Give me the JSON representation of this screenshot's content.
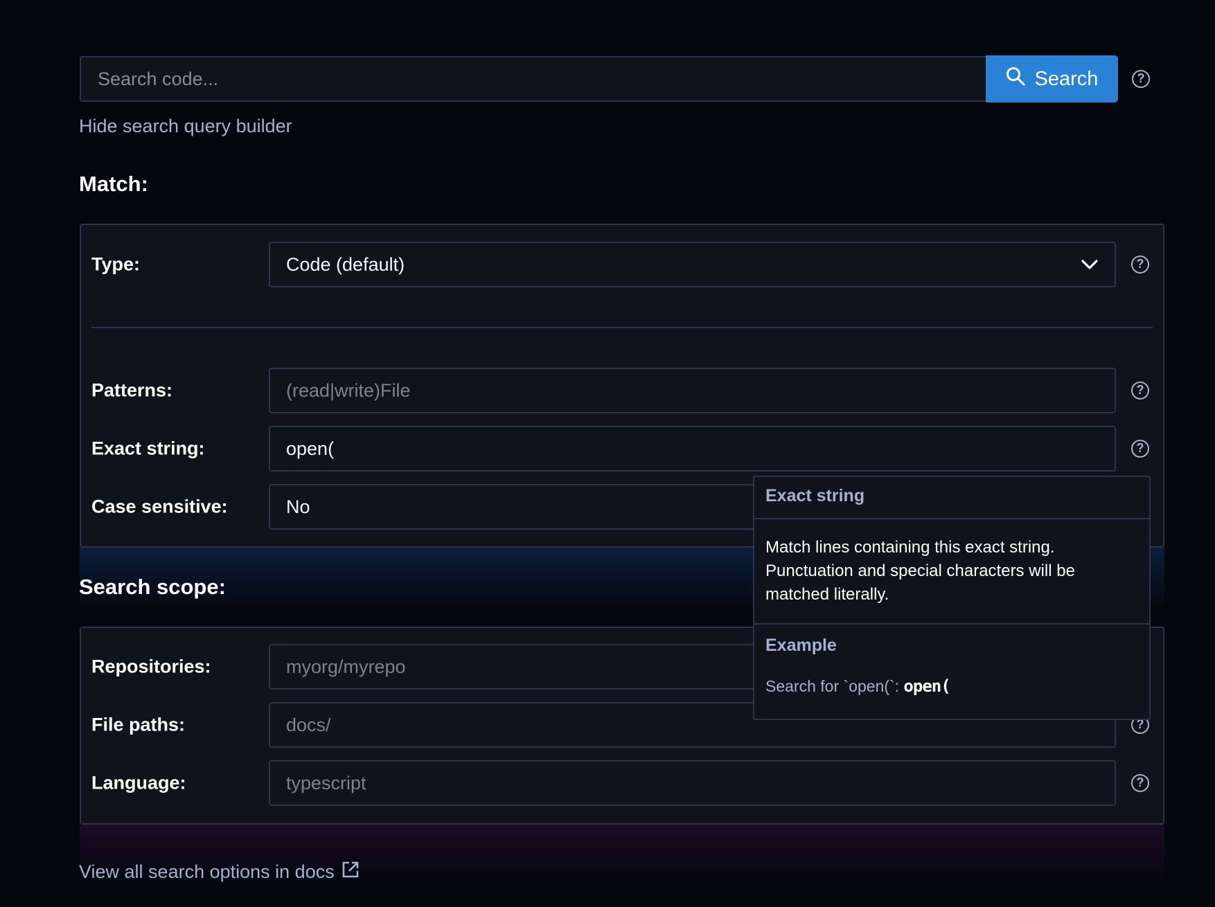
{
  "search": {
    "placeholder": "Search code...",
    "value": "",
    "button_label": "Search",
    "button_icon": "search-icon",
    "help_icon": "help-circle-icon"
  },
  "toggle_builder_link": "Hide search query builder",
  "match_section": {
    "title": "Match:",
    "type": {
      "label": "Type:",
      "value": "Code (default)"
    },
    "patterns": {
      "label": "Patterns:",
      "placeholder": "(read|write)File",
      "value": ""
    },
    "exact_string": {
      "label": "Exact string:",
      "value": "open("
    },
    "case_sensitive": {
      "label": "Case sensitive:",
      "value": "No"
    }
  },
  "scope_section": {
    "title": "Search scope:",
    "repositories": {
      "label": "Repositories:",
      "placeholder": "myorg/myrepo",
      "value": ""
    },
    "file_paths": {
      "label": "File paths:",
      "placeholder": "docs/",
      "value": ""
    },
    "language": {
      "label": "Language:",
      "placeholder": "typescript",
      "value": ""
    }
  },
  "tooltip": {
    "title": "Exact string",
    "body": "Match lines containing this exact string. Punctuation and special characters will be matched literally.",
    "example_title": "Example",
    "example_prefix": "Search for `open(`: ",
    "example_code": "open("
  },
  "docs_link": "View all search options in docs",
  "help_glyph": "?",
  "colors": {
    "background": "#05070f",
    "panel": "#0f131b",
    "border": "#2c3549",
    "accent": "#2a82d6",
    "link": "#a6b1cc"
  }
}
